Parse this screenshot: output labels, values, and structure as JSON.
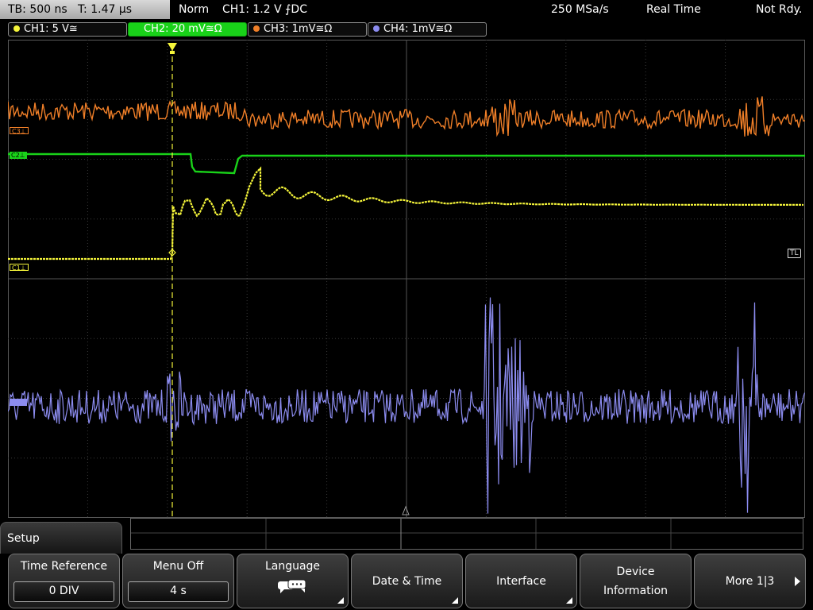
{
  "status": {
    "timebase": "TB: 500 ns",
    "trigger_time": "T: 1.47 µs",
    "mode": "Norm",
    "trigger": "CH1: 1.2 V ⨍DC",
    "sample_rate": "250 MSa/s",
    "acquisition": "Real Time",
    "state": "Not Rdy."
  },
  "channels": [
    {
      "label": "CH1: 5 V≅",
      "color": "#f5f53a",
      "active": false
    },
    {
      "label": "CH2: 20 mV≅Ω",
      "color": "#19d219",
      "active": true
    },
    {
      "label": "CH3: 1mV≅Ω",
      "color": "#f07f28",
      "active": false
    },
    {
      "label": "CH4: 1mV≅Ω",
      "color": "#8c8cf0",
      "active": false
    }
  ],
  "markers": {
    "c3": "C3⊥",
    "c2": "C2⊥",
    "c1": "C1⊥",
    "c4": "C4⊥",
    "trigger_level": "TL"
  },
  "menu": {
    "title": "Setup",
    "softkeys": [
      {
        "label": "Time Reference",
        "value": "0 DIV"
      },
      {
        "label": "Menu Off",
        "value": "4 s"
      },
      {
        "label": "Language",
        "icon": "speech-bubbles-icon"
      },
      {
        "label": "Date & Time"
      },
      {
        "label": "Interface"
      },
      {
        "label1": "Device",
        "label2": "Information"
      },
      {
        "label": "More 1|3"
      }
    ]
  }
}
